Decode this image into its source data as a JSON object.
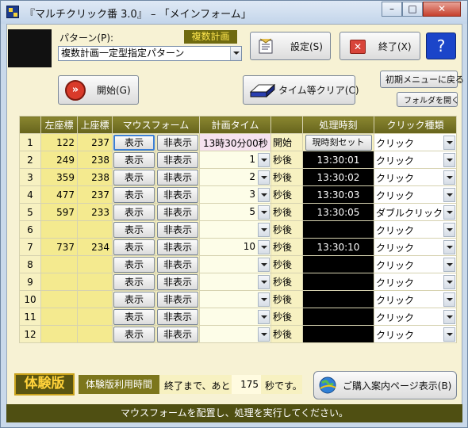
{
  "window": {
    "title": "『マルチクリック番 3.0』 – 「メインフォーム」",
    "min_glyph": "–",
    "max_glyph": "□",
    "close_glyph": "✕"
  },
  "pattern": {
    "label": "パターン(P):",
    "value": "複数計画一定型指定パターン",
    "badge": "複数計画"
  },
  "buttons": {
    "settings": "設定(S)",
    "exit": "終了(X)",
    "help_glyph": "?",
    "start": "開始(G)",
    "time_clear": "タイム等クリア(C)",
    "initial_menu": "初期メニューに戻る",
    "open_folder": "フォルダを開く",
    "set_current_time": "現時刻セット",
    "purchase": "ご購入案内ページ表示(B)"
  },
  "table": {
    "headers": [
      "",
      "左座標",
      "上座標",
      "マウスフォーム",
      "計画タイム",
      "処理時刻",
      "クリック種類"
    ],
    "show_label": "表示",
    "hide_label": "非表示",
    "suffix_start": "開始",
    "suffix_after": "秒後",
    "rows": [
      {
        "n": "1",
        "x": "122",
        "y": "237",
        "plan": "13時30分00秒",
        "time": "",
        "click": "クリック"
      },
      {
        "n": "2",
        "x": "249",
        "y": "238",
        "plan": "1",
        "time": "13:30:01",
        "click": "クリック"
      },
      {
        "n": "3",
        "x": "359",
        "y": "238",
        "plan": "2",
        "time": "13:30:02",
        "click": "クリック"
      },
      {
        "n": "4",
        "x": "477",
        "y": "237",
        "plan": "3",
        "time": "13:30:03",
        "click": "クリック"
      },
      {
        "n": "5",
        "x": "597",
        "y": "233",
        "plan": "5",
        "time": "13:30:05",
        "click": "ダブルクリック"
      },
      {
        "n": "6",
        "x": "",
        "y": "",
        "plan": "",
        "time": "",
        "click": "クリック"
      },
      {
        "n": "7",
        "x": "737",
        "y": "234",
        "plan": "10",
        "time": "13:30:10",
        "click": "クリック"
      },
      {
        "n": "8",
        "x": "",
        "y": "",
        "plan": "",
        "time": "",
        "click": "クリック"
      },
      {
        "n": "9",
        "x": "",
        "y": "",
        "plan": "",
        "time": "",
        "click": "クリック"
      },
      {
        "n": "10",
        "x": "",
        "y": "",
        "plan": "",
        "time": "",
        "click": "クリック"
      },
      {
        "n": "11",
        "x": "",
        "y": "",
        "plan": "",
        "time": "",
        "click": "クリック"
      },
      {
        "n": "12",
        "x": "",
        "y": "",
        "plan": "",
        "time": "",
        "click": "クリック"
      }
    ]
  },
  "trial": {
    "badge": "体験版",
    "time_label": "体験版利用時間",
    "remaining_prefix": "終了まで、あと",
    "seconds": "175",
    "remaining_suffix": "秒です。"
  },
  "status": "マウスフォームを配置し、処理を実行してください。"
}
